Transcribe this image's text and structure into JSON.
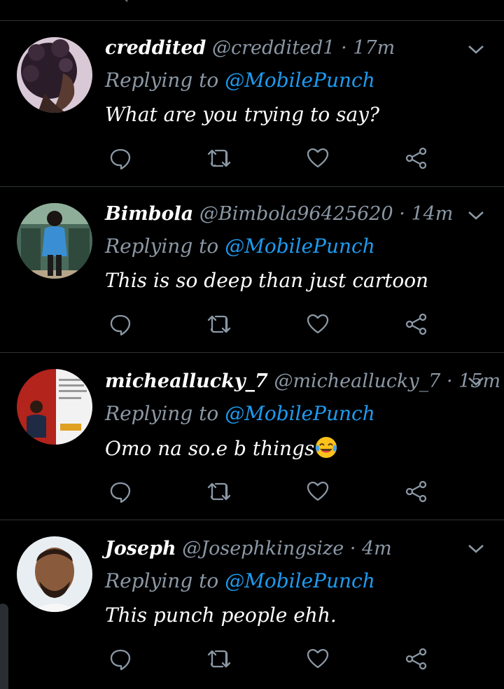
{
  "colors": {
    "background": "#000000",
    "divider": "#2f3336",
    "muted_text": "#8b98a5",
    "mention_link": "#1d9bf0",
    "primary_text": "#ffffff"
  },
  "icons": {
    "reply": "speech-bubble-icon",
    "retweet": "retweet-arrows-icon",
    "like": "heart-outline-icon",
    "share": "share-nodes-icon",
    "more": "chevron-down-icon"
  },
  "tweets": [
    {
      "name": "creddited",
      "handle": "@creddited1",
      "separator": "·",
      "time": "17m",
      "replying_prefix": "Replying to",
      "replying_to": "@MobilePunch",
      "text": "What are you trying to say?",
      "emoji": ""
    },
    {
      "name": "Bimbola",
      "handle": "@Bimbola96425620",
      "separator": "·",
      "time": "14m",
      "replying_prefix": "Replying to",
      "replying_to": "@MobilePunch",
      "text": "This is so deep than just cartoon",
      "emoji": ""
    },
    {
      "name": "micheallucky_7",
      "handle": "@micheallucky_7",
      "separator": "·",
      "time": "15m",
      "replying_prefix": "Replying to",
      "replying_to": "@MobilePunch",
      "text": "Omo na so.e b things",
      "emoji": "😂"
    },
    {
      "name": "Joseph",
      "handle": "@Josephkingsize",
      "separator": "·",
      "time": "4m",
      "replying_prefix": "Replying to",
      "replying_to": "@MobilePunch",
      "text": "This punch people ehh.",
      "emoji": ""
    }
  ]
}
